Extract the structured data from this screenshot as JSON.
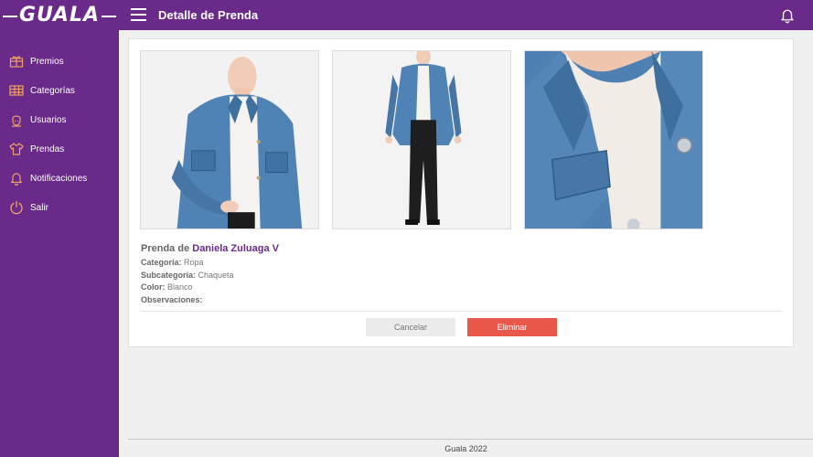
{
  "app": {
    "logo": "GUALA",
    "title": "Detalle de Prenda"
  },
  "icons": {
    "menu": "hamburger-icon",
    "bell": "bell-icon"
  },
  "sidebar": {
    "items": [
      {
        "label": "Premios",
        "icon": "gift-icon"
      },
      {
        "label": "Categorías",
        "icon": "categories-icon"
      },
      {
        "label": "Usuarios",
        "icon": "user-icon"
      },
      {
        "label": "Prendas",
        "icon": "shirt-icon"
      },
      {
        "label": "Notificaciones",
        "icon": "bell-icon"
      },
      {
        "label": "Salir",
        "icon": "power-icon"
      }
    ]
  },
  "garment": {
    "owner_prefix": "Prenda de",
    "owner_name": "Daniela Zuluaga V",
    "category_label": "Categoría:",
    "category_value": "Ropa",
    "subcategory_label": "Subcategoría:",
    "subcategory_value": "Chaqueta",
    "color_label": "Color:",
    "color_value": "Blanco",
    "observations_label": "Observaciones:",
    "observations_value": ""
  },
  "actions": {
    "cancel": "Cancelar",
    "delete": "Eliminar"
  },
  "footer": {
    "text": "Guala 2022"
  },
  "colors": {
    "brand": "#6a2a8a",
    "danger": "#e8574a",
    "denim": "#4a7aab"
  }
}
